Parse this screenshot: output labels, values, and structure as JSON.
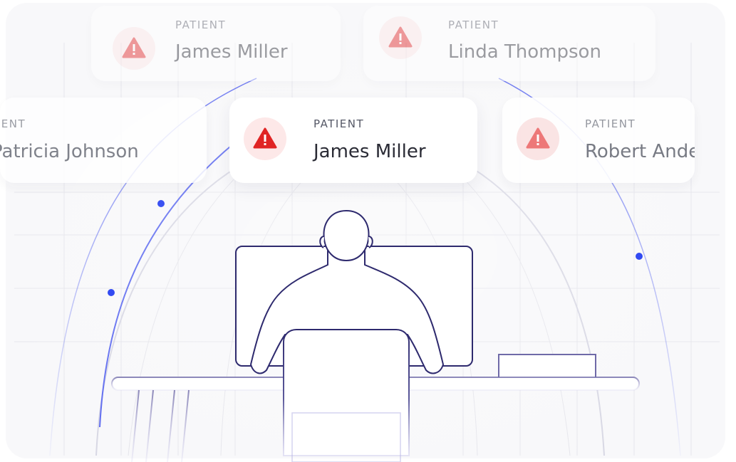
{
  "cards": {
    "top_left": {
      "label": "PATIENT",
      "name": "James Miller",
      "icon": "warning-icon"
    },
    "top_right": {
      "label": "PATIENT",
      "name": "Linda Thompson",
      "icon": "warning-icon"
    },
    "mid_left": {
      "label": "PATIENT",
      "name": "Patricia Johnson",
      "icon": "warning-icon"
    },
    "center": {
      "label": "PATIENT",
      "name": "James Miller",
      "icon": "warning-icon"
    },
    "mid_right": {
      "label": "PATIENT",
      "name": "Robert Anderson",
      "icon": "warning-icon"
    }
  },
  "colors": {
    "alert_red": "#e02424",
    "alert_bg": "#fde8e8",
    "line_navy": "#2e2a6e",
    "orbit_blue": "#5f6cf0",
    "dot_blue": "#1a35f0"
  },
  "illustration": "person-at-desk-illustration"
}
